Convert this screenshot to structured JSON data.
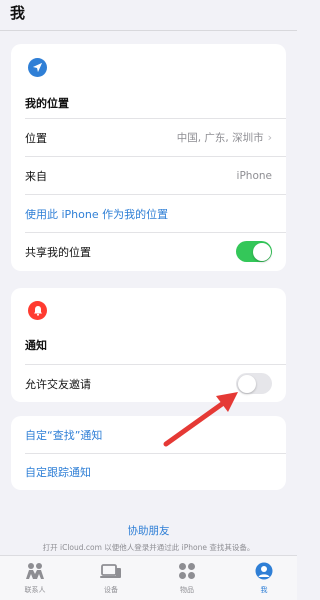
{
  "header": {
    "title": "我"
  },
  "location_card": {
    "heading": "我的位置",
    "location_label": "位置",
    "location_value": "中国, 广东, 深圳市",
    "from_label": "来自",
    "from_value": "iPhone",
    "use_this_iphone": "使用此 iPhone 作为我的位置",
    "share_label": "共享我的位置",
    "share_on": true
  },
  "notify_card": {
    "heading": "通知",
    "allow_invites_label": "允许交友邀请",
    "allow_invites_on": false
  },
  "links_card": {
    "custom_find": "自定“查找”通知",
    "custom_tracking": "自定跟踪通知"
  },
  "help": {
    "link": "协助朋友",
    "note": "打开 iCloud.com 以便他人登录并通过此 iPhone 查找其设备。"
  },
  "tabbar": {
    "tabs": [
      {
        "label": "联系人",
        "icon": "people-icon"
      },
      {
        "label": "设备",
        "icon": "devices-icon"
      },
      {
        "label": "物品",
        "icon": "items-icon"
      },
      {
        "label": "我",
        "icon": "person-icon",
        "active": true
      }
    ]
  },
  "colors": {
    "accent": "#2f7fd6",
    "toggle_on": "#34c759",
    "notify_icon": "#ff3b30",
    "annotation_arrow": "#e53935"
  }
}
